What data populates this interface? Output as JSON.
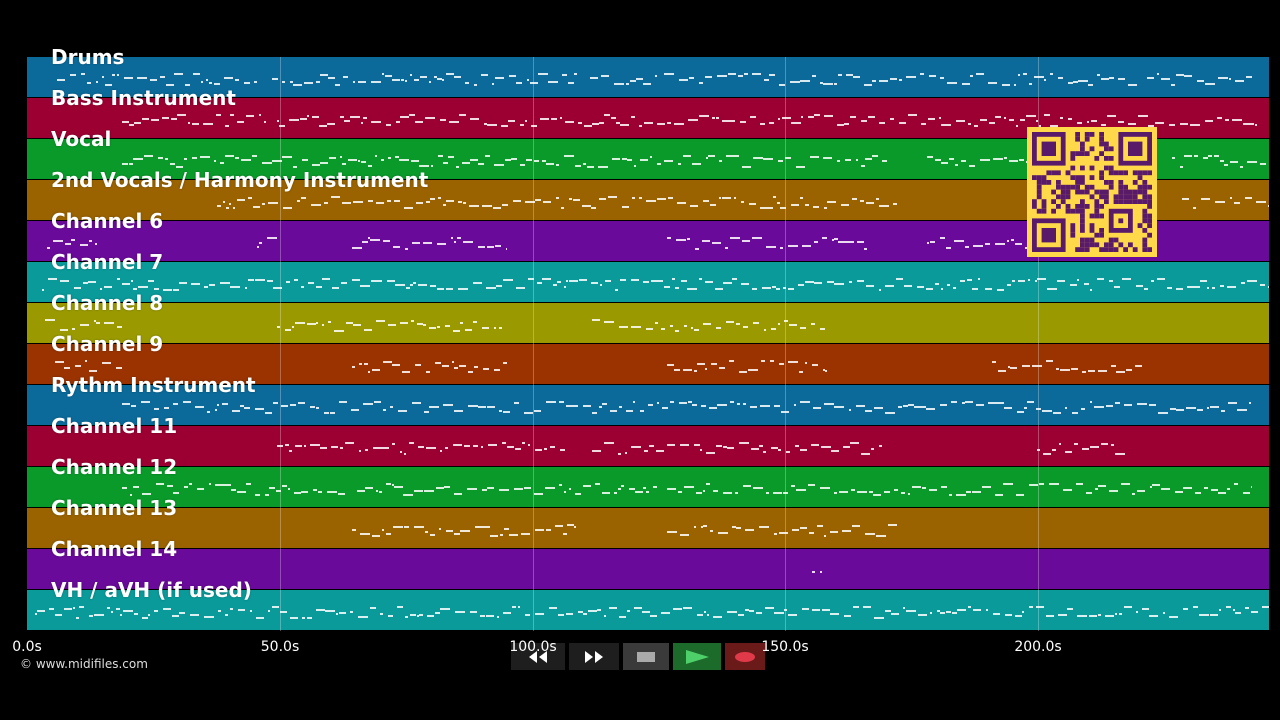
{
  "tracks": [
    {
      "name": "Drums",
      "color": "#0b6a9a"
    },
    {
      "name": "Bass Instrument",
      "color": "#9c0033"
    },
    {
      "name": "Vocal",
      "color": "#0a9a2a"
    },
    {
      "name": "2nd Vocals / Harmony Instrument",
      "color": "#9a6300"
    },
    {
      "name": "Channel 6",
      "color": "#6a0a9a"
    },
    {
      "name": "Channel 7",
      "color": "#0a9a9a"
    },
    {
      "name": "Channel 8",
      "color": "#9a9a00"
    },
    {
      "name": "Channel 9",
      "color": "#9a3300"
    },
    {
      "name": "Rythm Instrument",
      "color": "#0b6a9a"
    },
    {
      "name": "Channel 11",
      "color": "#9c0033"
    },
    {
      "name": "Channel 12",
      "color": "#0a9a2a"
    },
    {
      "name": "Channel 13",
      "color": "#9a6300"
    },
    {
      "name": "Channel 14",
      "color": "#6a0a9a"
    },
    {
      "name": "VH / aVH (if used)",
      "color": "#0a9a9a"
    }
  ],
  "timeline": {
    "ticks": [
      "0.0s",
      "50.0s",
      "100.0s",
      "150.0s",
      "200.0s"
    ],
    "tick_values": [
      0,
      50,
      100,
      150,
      200
    ],
    "max_seconds": 245
  },
  "copyright": "© www.midifiles.com",
  "qr": {
    "color": "#ffd94a",
    "dark": "#5a1a6a"
  },
  "transport": {
    "buttons": [
      {
        "name": "rewind-button",
        "icon": "rewind-icon",
        "bg": "#1e1e1e"
      },
      {
        "name": "fast-forward-button",
        "icon": "fast-forward-icon",
        "bg": "#1e1e1e"
      },
      {
        "name": "stop-button",
        "icon": "stop-icon",
        "bg": "#3a3a3a"
      },
      {
        "name": "play-button",
        "icon": "play-icon",
        "bg": "#1d6b2a"
      },
      {
        "name": "record-button",
        "icon": "record-icon",
        "bg": "#6b1a1a"
      }
    ]
  }
}
